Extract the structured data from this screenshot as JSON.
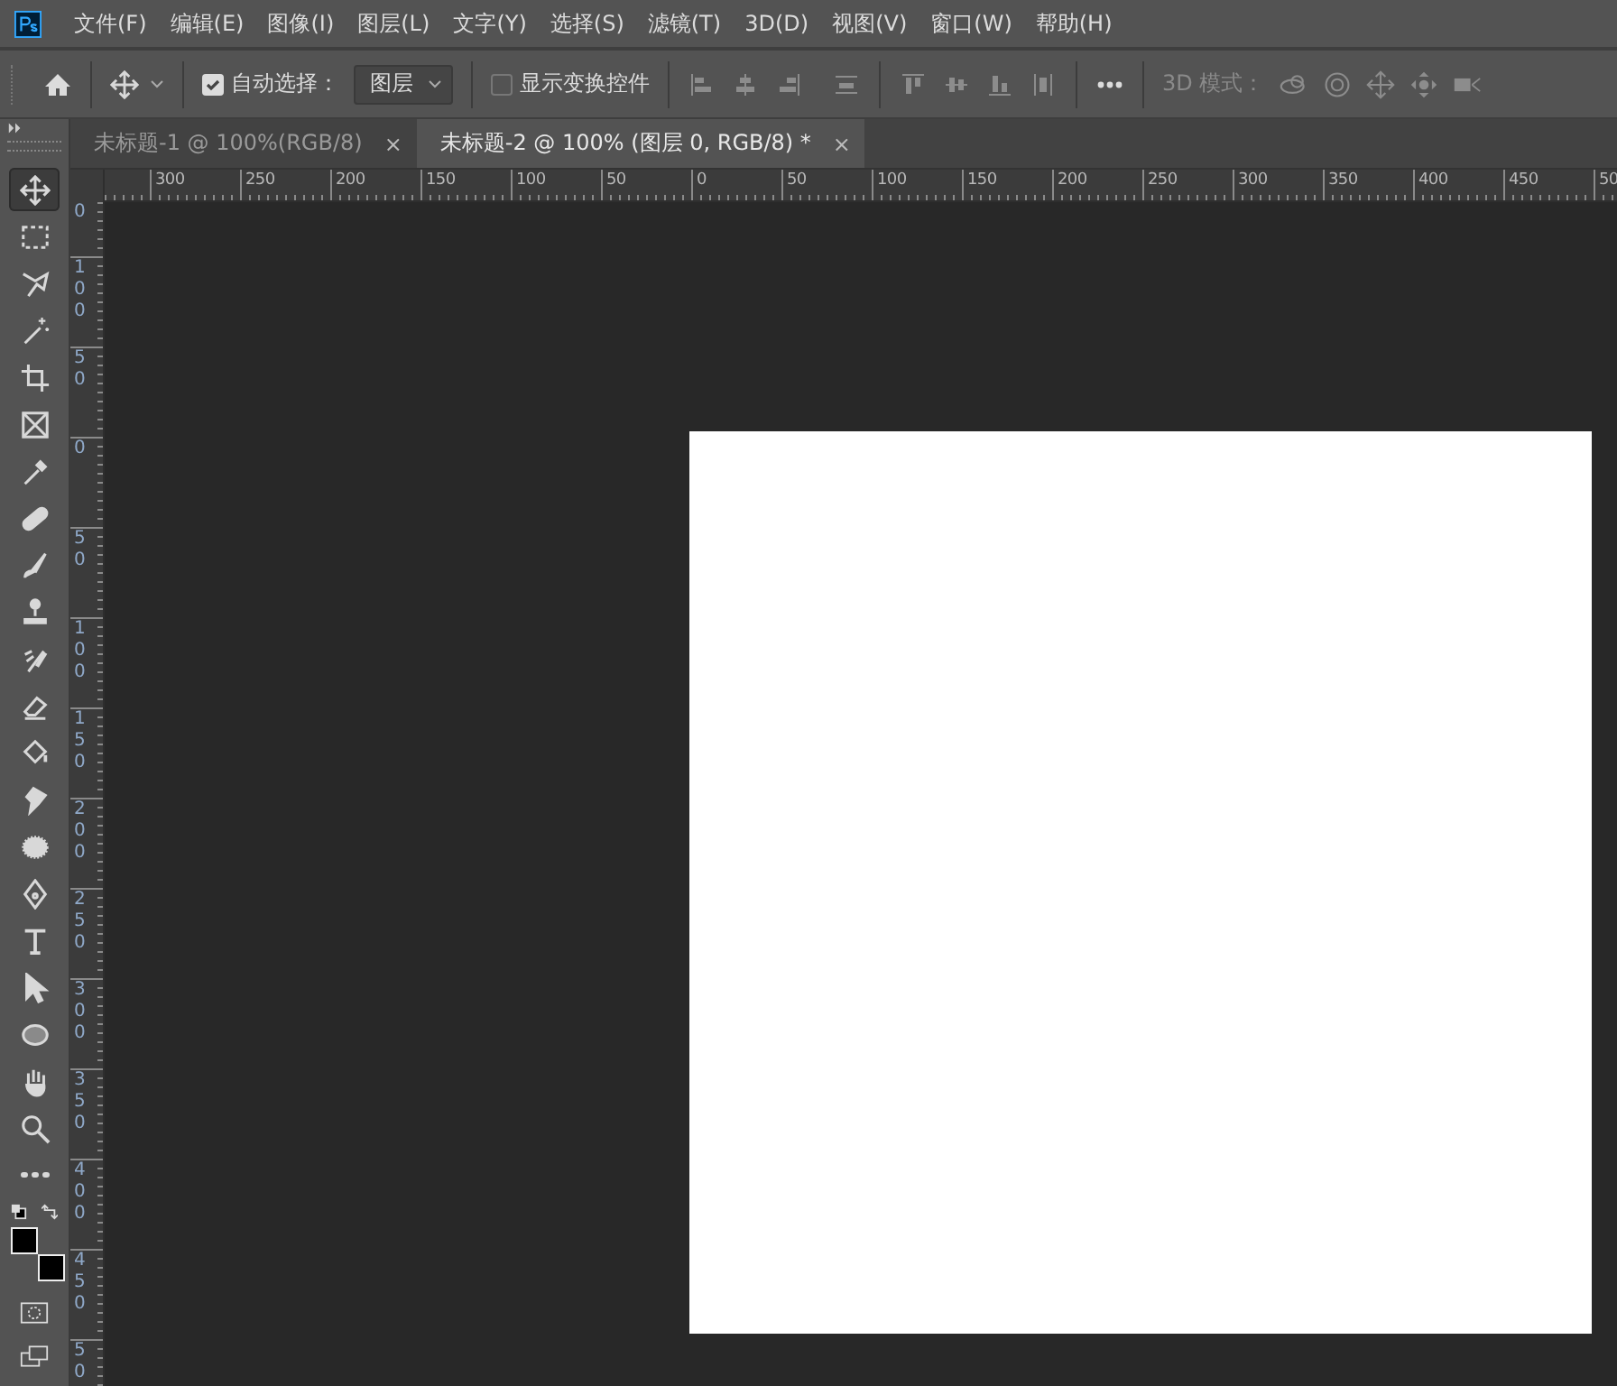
{
  "menu_bar": {
    "items": [
      "文件(F)",
      "编辑(E)",
      "图像(I)",
      "图层(L)",
      "文字(Y)",
      "选择(S)",
      "滤镜(T)",
      "3D(D)",
      "视图(V)",
      "窗口(W)",
      "帮助(H)"
    ]
  },
  "options_bar": {
    "auto_select": {
      "label": "自动选择：",
      "checked": true
    },
    "auto_select_target": {
      "value": "图层"
    },
    "show_transform": {
      "label": "显示变换控件",
      "checked": false
    },
    "mode_3d": {
      "label": "3D 模式：",
      "disabled": true
    }
  },
  "tabs": [
    {
      "label": "未标题-1 @ 100%(RGB/8)",
      "close": "×",
      "selected": false
    },
    {
      "label": "未标题-2 @ 100% (图层 0, RGB/8) *",
      "close": "×",
      "selected": true
    }
  ],
  "toolbar": {
    "tools": [
      {
        "kind": "move",
        "selected": true
      },
      {
        "kind": "marquee",
        "selected": false
      },
      {
        "kind": "lasso",
        "selected": false
      },
      {
        "kind": "wand",
        "selected": false
      },
      {
        "kind": "crop",
        "selected": false
      },
      {
        "kind": "frame",
        "selected": false
      },
      {
        "kind": "eyedropper",
        "selected": false
      },
      {
        "kind": "bandage",
        "selected": false
      },
      {
        "kind": "brush",
        "selected": false
      },
      {
        "kind": "stamp",
        "selected": false
      },
      {
        "kind": "history",
        "selected": false
      },
      {
        "kind": "eraser",
        "selected": false
      },
      {
        "kind": "bucket",
        "selected": false
      },
      {
        "kind": "smudge",
        "selected": false
      },
      {
        "kind": "sponge",
        "selected": false
      },
      {
        "kind": "pen",
        "selected": false
      },
      {
        "kind": "type",
        "selected": false
      },
      {
        "kind": "arrow",
        "selected": false
      },
      {
        "kind": "ellipse",
        "selected": false
      },
      {
        "kind": "hand",
        "selected": false
      },
      {
        "kind": "zoom",
        "selected": false
      },
      {
        "kind": "more",
        "selected": false
      }
    ],
    "foreground": {
      "color": "#000000"
    },
    "background": {
      "color": "#000000"
    }
  },
  "horizontal_ruler": {
    "labels": [
      "300",
      "250",
      "200",
      "150",
      "100",
      "50",
      "0",
      "50",
      "100",
      "150",
      "200",
      "250",
      "300",
      "350",
      "400",
      "450",
      "50"
    ]
  },
  "vertical_ruler": {
    "labels": [
      "0",
      "100",
      "50",
      "0",
      "50",
      "100",
      "150",
      "200",
      "250",
      "300",
      "350",
      "400",
      "450",
      "50"
    ]
  }
}
